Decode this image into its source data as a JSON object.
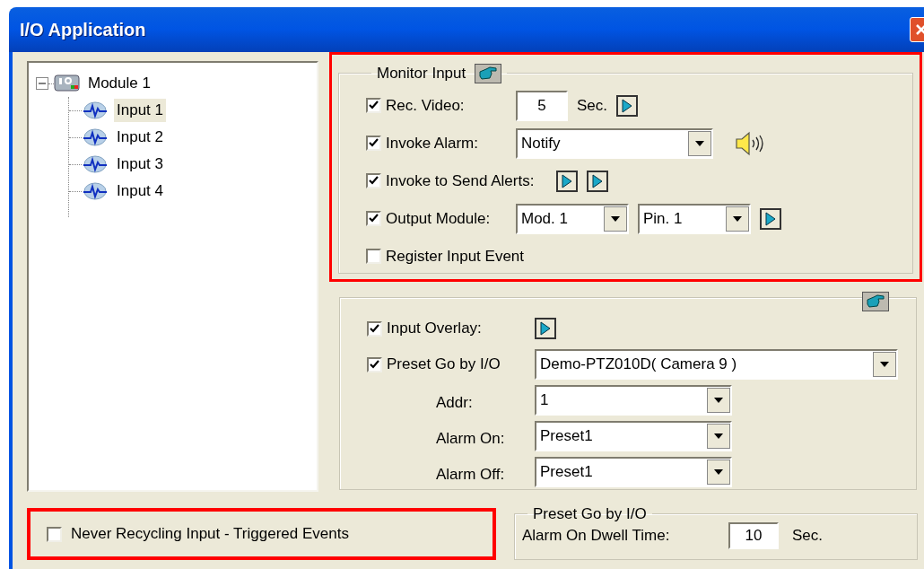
{
  "window": {
    "title": "I/O Application"
  },
  "tree": {
    "items": [
      {
        "label": "Module 1",
        "expanded": true,
        "children": [
          {
            "label": "Input 1",
            "selected": true
          },
          {
            "label": "Input 2",
            "selected": false
          },
          {
            "label": "Input 3",
            "selected": false
          },
          {
            "label": "Input 4",
            "selected": false
          }
        ]
      }
    ]
  },
  "monitor_input": {
    "title": "Monitor Input",
    "highlighted": true,
    "rows": [
      {
        "kind": "checkbox",
        "label": "Rec. Video:",
        "checked": true,
        "controls": [
          {
            "kind": "field",
            "value": "5"
          },
          {
            "kind": "text",
            "text": "Sec."
          },
          {
            "kind": "arrow_button"
          }
        ]
      },
      {
        "kind": "checkbox",
        "label": "Invoke Alarm:",
        "checked": true,
        "controls": [
          {
            "kind": "dropdown",
            "value": "Notify"
          },
          {
            "kind": "speaker"
          }
        ]
      },
      {
        "kind": "checkbox",
        "label": "Invoke to Send Alerts:",
        "checked": true,
        "controls": [
          {
            "kind": "arrow_button"
          },
          {
            "kind": "arrow_button"
          }
        ]
      },
      {
        "kind": "checkbox",
        "label": "Output Module:",
        "checked": true,
        "controls": [
          {
            "kind": "small_dropdown",
            "value": "Mod. 1"
          },
          {
            "kind": "small_dropdown",
            "value": "Pin. 1"
          },
          {
            "kind": "arrow_button"
          }
        ]
      },
      {
        "kind": "checkbox",
        "label": "Register Input Event",
        "checked": false,
        "controls": []
      }
    ]
  },
  "preset_panel": {
    "rows": [
      {
        "kind": "checkbox",
        "label": "Input Overlay:",
        "checked": true,
        "controls": [
          {
            "kind": "arrow_button"
          }
        ]
      },
      {
        "kind": "checkbox",
        "label": "Preset Go by I/O",
        "checked": true,
        "controls": [
          {
            "kind": "wide_dropdown",
            "value": "Demo-PTZ010D( Camera 9 )"
          }
        ]
      },
      {
        "kind": "label",
        "label": "Addr:",
        "controls": [
          {
            "kind": "dropdown",
            "value": "1"
          }
        ]
      },
      {
        "kind": "label",
        "label": "Alarm On:",
        "controls": [
          {
            "kind": "dropdown",
            "value": "Preset1"
          }
        ]
      },
      {
        "kind": "label",
        "label": "Alarm Off:",
        "controls": [
          {
            "kind": "dropdown",
            "value": "Preset1"
          }
        ]
      }
    ]
  },
  "recycling_option": {
    "label": "Never Recycling Input - Triggered Events",
    "checked": false,
    "highlighted": true
  },
  "dwell_group": {
    "title": "Preset Go by I/O",
    "label": "Alarm On Dwell Time:",
    "value": "10",
    "unit": "Sec."
  }
}
